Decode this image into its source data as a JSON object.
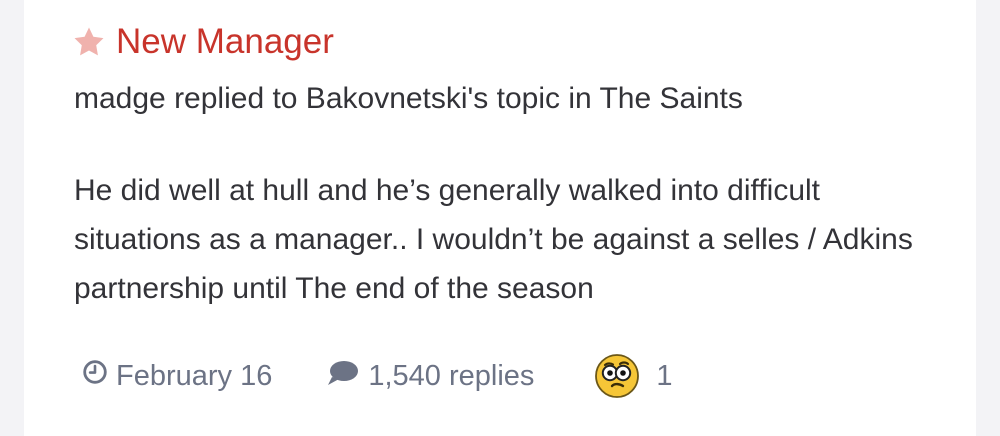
{
  "topic": {
    "title": "New Manager",
    "activity": "madge replied to Bakovnetski's topic in The Saints",
    "body": "He did well at hull and he’s generally walked into difficult situations as a manager.. I wouldn’t be against a selles / Adkins partnership until The end of the season"
  },
  "meta": {
    "date": "February 16",
    "replies": "1,540 replies",
    "reaction_count": "1"
  },
  "icons": {
    "title": "star-icon",
    "date": "clock-icon",
    "replies": "comment-icon",
    "reaction": "confused-emoji-icon"
  },
  "colors": {
    "title": "#c8342b",
    "star": "#f0b2ad",
    "meta": "#6c7385",
    "text": "#333338"
  }
}
